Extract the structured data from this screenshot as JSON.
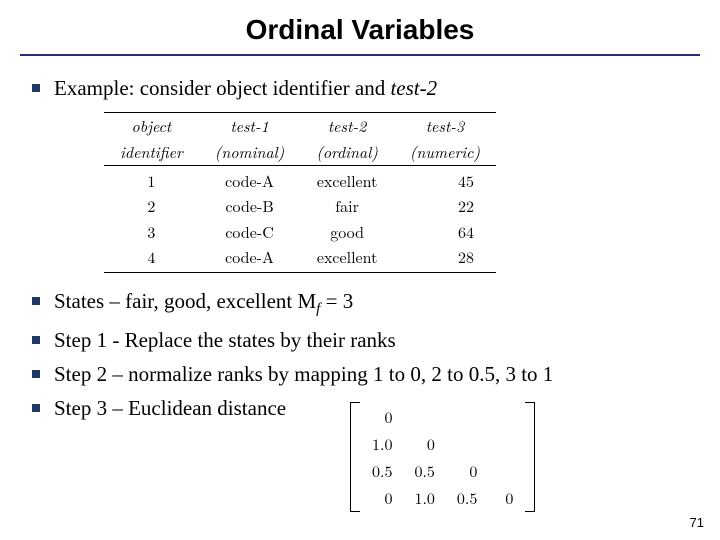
{
  "title": "Ordinal Variables",
  "bullets": {
    "b1_pre": "Example: consider object identifier and ",
    "b1_ital": "test-2",
    "b2_pre": "States – fair, good, excellent  M",
    "b2_sub": "f",
    "b2_post": " = 3",
    "b3": "Step 1 - Replace the states by their ranks",
    "b4": "Step 2 – normalize ranks by mapping 1 to 0, 2 to 0.5, 3 to 1",
    "b5": "Step 3 – Euclidean distance"
  },
  "table": {
    "headers": {
      "h1a": "object",
      "h1b": "identifier",
      "h2a": "test-1",
      "h2b": "(nominal)",
      "h3a": "test-2",
      "h3b": "(ordinal)",
      "h4a": "test-3",
      "h4b": "(numeric)"
    },
    "rows": [
      {
        "id": "1",
        "t1": "code-A",
        "t2": "excellent",
        "t3": "45"
      },
      {
        "id": "2",
        "t1": "code-B",
        "t2": "fair",
        "t3": "22"
      },
      {
        "id": "3",
        "t1": "code-C",
        "t2": "good",
        "t3": "64"
      },
      {
        "id": "4",
        "t1": "code-A",
        "t2": "excellent",
        "t3": "28"
      }
    ]
  },
  "matrix": [
    [
      "0",
      "",
      "",
      ""
    ],
    [
      "1.0",
      "0",
      "",
      ""
    ],
    [
      "0.5",
      "0.5",
      "0",
      ""
    ],
    [
      "0",
      "1.0",
      "0.5",
      "0"
    ]
  ],
  "page_number": "71"
}
